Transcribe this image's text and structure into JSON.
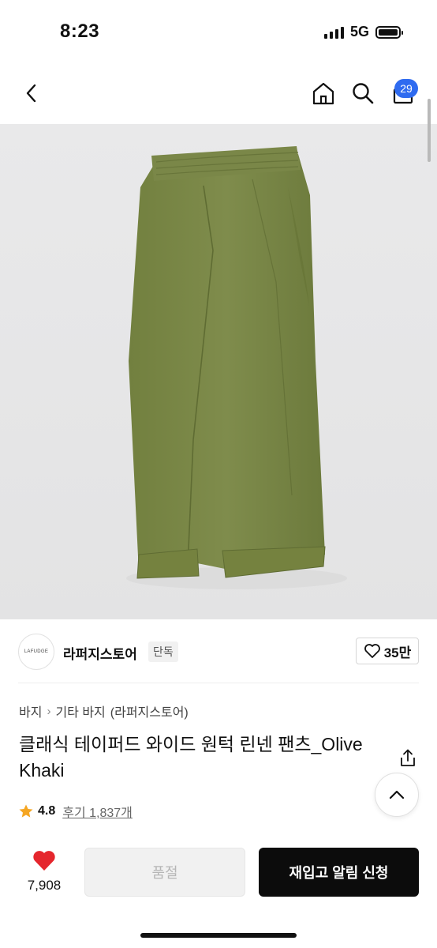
{
  "status_bar": {
    "time": "8:23",
    "network": "5G"
  },
  "nav": {
    "cart_count": "29"
  },
  "store": {
    "logo_text": "LAFUDGE",
    "name": "라퍼지스토어",
    "tag": "단독",
    "likes": "35만"
  },
  "breadcrumb": {
    "category": "바지",
    "subcategory": "기타 바지",
    "brand": "(라퍼지스토어)"
  },
  "product": {
    "title": "클래식 테이퍼드 와이드 원턱 린넨 팬츠_Olive Khaki",
    "rating": "4.8",
    "reviews": "후기 1,837개"
  },
  "bottom_bar": {
    "wish_count": "7,908",
    "soldout_label": "품절",
    "restock_label": "재입고 알림 신청"
  },
  "colors": {
    "accent_badge": "#2f6bf0",
    "heart": "#e5262d",
    "star": "#f5a623",
    "pants": "#7d8a4b"
  }
}
